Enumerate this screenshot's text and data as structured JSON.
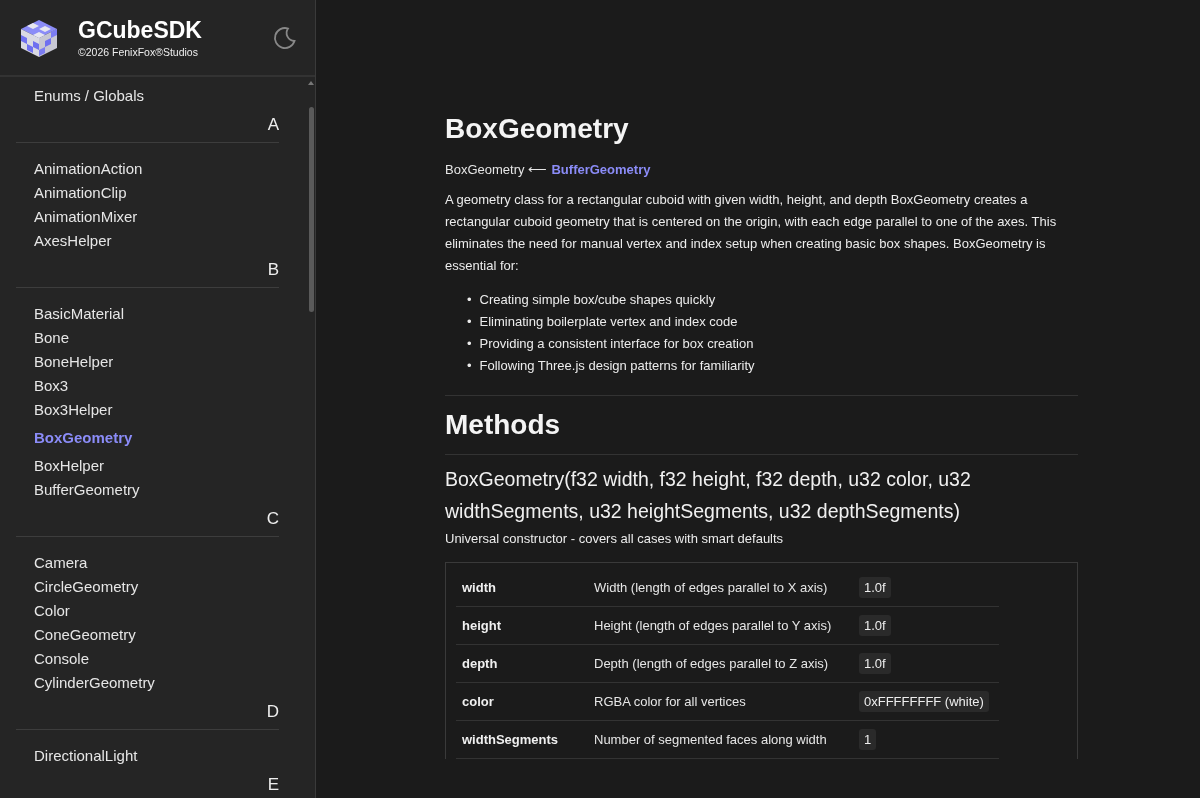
{
  "sidebar": {
    "logo_title": "GCubeSDK",
    "copyright": "©2026 FenixFox®Studios",
    "groups": [
      {
        "items": [
          {
            "label": "Enums / Globals",
            "selected": false
          }
        ],
        "letter": "A"
      },
      {
        "items": [
          {
            "label": "AnimationAction",
            "selected": false
          },
          {
            "label": "AnimationClip",
            "selected": false
          },
          {
            "label": "AnimationMixer",
            "selected": false
          },
          {
            "label": "AxesHelper",
            "selected": false
          }
        ],
        "letter": "B"
      },
      {
        "items": [
          {
            "label": "BasicMaterial",
            "selected": false
          },
          {
            "label": "Bone",
            "selected": false
          },
          {
            "label": "BoneHelper",
            "selected": false
          },
          {
            "label": "Box3",
            "selected": false
          },
          {
            "label": "Box3Helper",
            "selected": false
          },
          {
            "label": "BoxGeometry",
            "selected": true
          },
          {
            "label": "BoxHelper",
            "selected": false
          },
          {
            "label": "BufferGeometry",
            "selected": false
          }
        ],
        "letter": "C"
      },
      {
        "items": [
          {
            "label": "Camera",
            "selected": false
          },
          {
            "label": "CircleGeometry",
            "selected": false
          },
          {
            "label": "Color",
            "selected": false
          },
          {
            "label": "ConeGeometry",
            "selected": false
          },
          {
            "label": "Console",
            "selected": false
          },
          {
            "label": "CylinderGeometry",
            "selected": false
          }
        ],
        "letter": "D"
      },
      {
        "items": [
          {
            "label": "DirectionalLight",
            "selected": false
          }
        ],
        "letter": "E"
      }
    ]
  },
  "main": {
    "title": "BoxGeometry",
    "inheritance": {
      "class": "BoxGeometry",
      "arrow": "⟵",
      "parent": "BufferGeometry"
    },
    "description": "A geometry class for a rectangular cuboid with given width, height, and depth BoxGeometry creates a rectangular cuboid geometry that is centered on the origin, with each edge parallel to one of the axes. This eliminates the need for manual vertex and index setup when creating basic box shapes. BoxGeometry is essential for:",
    "bullets": [
      {
        "marker": "•",
        "text": "Creating simple box/cube shapes quickly"
      },
      {
        "marker": "•",
        "text": "Eliminating boilerplate vertex and index code"
      },
      {
        "marker": "•",
        "text": "Providing a consistent interface for box creation"
      },
      {
        "marker": "•",
        "text": "Following Three.js design patterns for familiarity"
      }
    ],
    "section_title": "Methods",
    "method": {
      "signature": "BoxGeometry(f32 width, f32 height, f32 depth, u32 color, u32 widthSegments, u32 heightSegments, u32 depthSegments)",
      "summary": "Universal constructor - covers all cases with smart defaults",
      "params": [
        {
          "name": "width",
          "description": "Width (length of edges parallel to X axis)",
          "default": "1.0f"
        },
        {
          "name": "height",
          "description": "Height (length of edges parallel to Y axis)",
          "default": "1.0f"
        },
        {
          "name": "depth",
          "description": "Depth (length of edges parallel to Z axis)",
          "default": "1.0f"
        },
        {
          "name": "color",
          "description": "RGBA color for all vertices",
          "default": "0xFFFFFFFF (white)"
        },
        {
          "name": "widthSegments",
          "description": "Number of segmented faces along width",
          "default": "1"
        }
      ]
    }
  }
}
